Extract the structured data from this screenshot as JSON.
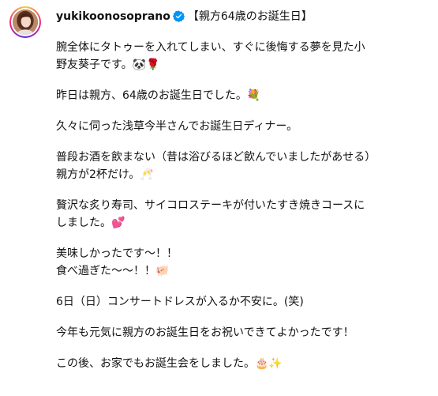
{
  "post": {
    "username": "yukikoonosoprano",
    "title": "【親方64歳のお誕生日】",
    "paragraphs": [
      [
        "腕全体にタトゥーを入れてしまい、すぐに後悔する夢を見た小",
        "野友葵子です。🐼🌹"
      ],
      [
        "昨日は親方、64歳のお誕生日でした。💐"
      ],
      [
        "久々に伺った浅草今半さんでお誕生日ディナー。"
      ],
      [
        "普段お酒を飲まない（昔は浴びるほど飲んでいましたがあせる）",
        "親方が2杯だけ。🥂"
      ],
      [
        "贅沢な炙り寿司、サイコロステーキが付いたすき焼きコースに",
        "しました。💕"
      ],
      [
        "美味しかったです〜！！",
        "食べ過ぎた〜〜！！🐖"
      ],
      [
        "6日（日）コンサートドレスが入るか不安に。(笑)"
      ],
      [
        "今年も元気に親方のお誕生日をお祝いできてよかったです！"
      ],
      [
        "この後、お家でもお誕生会をしました。🎂✨"
      ]
    ]
  },
  "icons": {
    "verified": "verified-badge-icon",
    "avatar": "profile-avatar"
  },
  "colors": {
    "verified": "#0095f6",
    "text": "#111111"
  }
}
